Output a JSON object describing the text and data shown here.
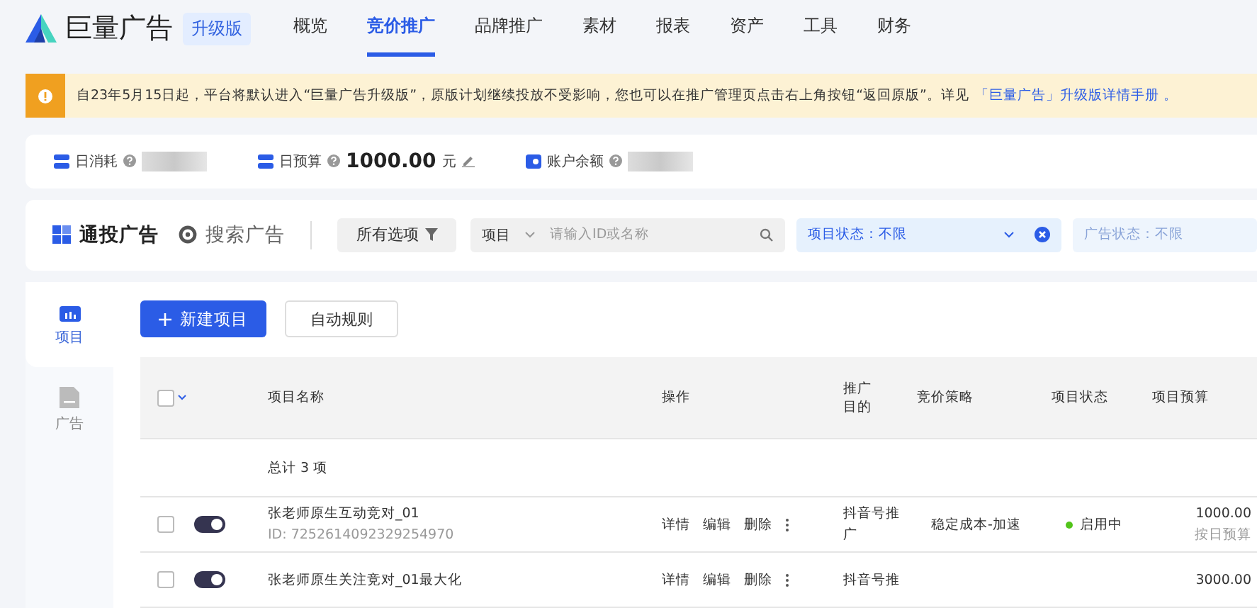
{
  "header": {
    "brand": "巨量广告",
    "badge": "升级版",
    "nav": [
      {
        "label": "概览",
        "selected": false
      },
      {
        "label": "竞价推广",
        "selected": true
      },
      {
        "label": "品牌推广",
        "selected": false
      },
      {
        "label": "素材",
        "selected": false
      },
      {
        "label": "报表",
        "selected": false
      },
      {
        "label": "资产",
        "selected": false
      },
      {
        "label": "工具",
        "selected": false
      },
      {
        "label": "财务",
        "selected": false
      }
    ]
  },
  "notice": {
    "text": "自23年5月15日起，平台将默认进入“巨量广告升级版”，原版计划继续投放不受影响，您也可以在推广管理页点击右上角按钮“返回原版”。详见",
    "link": "「巨量广告」升级版详情手册 。"
  },
  "stats": [
    {
      "kind": "hidden",
      "label": "日消耗"
    },
    {
      "kind": "value",
      "label": "日预算",
      "value": "1000.00",
      "unit": "元"
    },
    {
      "kind": "hidden",
      "label": "账户余额"
    }
  ],
  "filters": {
    "ad_types": [
      {
        "label": "通投广告",
        "selected": true
      },
      {
        "label": "搜索广告",
        "selected": false
      }
    ],
    "all_options": "所有选项",
    "scope": "项目",
    "search": {
      "placeholder": "请输入ID或名称"
    },
    "project_status": "项目状态：不限",
    "ad_status": "广告状态：不限"
  },
  "sidebar": [
    {
      "label": "项目",
      "selected": true
    },
    {
      "label": "广告",
      "selected": false
    }
  ],
  "actions": {
    "primary": "新建项目",
    "secondary": "自动规则"
  },
  "table": {
    "columns": [
      "项目名称",
      "操作",
      "推广目的",
      "竞价策略",
      "项目状态",
      "项目预算"
    ],
    "total": "总计 3 项",
    "all_checked": false,
    "rows": [
      {
        "checked": false,
        "on": true,
        "name": "张老师原生互动竞对_01",
        "id": "ID: 7252614092329254970",
        "ops": [
          "详情",
          "编辑",
          "删除"
        ],
        "purpose": "抖音号推广",
        "strategy": "稳定成本-加速",
        "status": "启用中",
        "color": "#52c41a",
        "budget": "1000.00",
        "budget_type": "按日预算"
      },
      {
        "checked": false,
        "on": true,
        "name": "张老师原生关注竞对_01最大化",
        "ops": [
          "详情",
          "编辑",
          "删除"
        ],
        "purpose": "抖音号推",
        "budget": "3000.00"
      }
    ]
  }
}
